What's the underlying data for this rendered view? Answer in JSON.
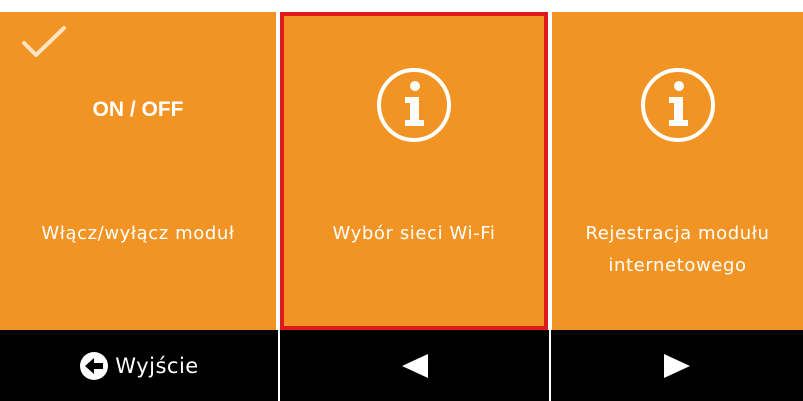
{
  "tiles": [
    {
      "heading": "ON / OFF",
      "label": "Włącz/wyłącz moduł",
      "icon": "checkmark-icon",
      "active": true
    },
    {
      "label": "Wybór sieci Wi-Fi",
      "icon": "info-icon",
      "selected": true
    },
    {
      "label": "Rejestracja modułu internetowego",
      "icon": "info-icon"
    }
  ],
  "footer": {
    "exit_label": "Wyjście",
    "exit_icon": "exit-arrow-icon",
    "prev_icon": "triangle-left-icon",
    "next_icon": "triangle-right-icon"
  },
  "colors": {
    "tile": "#f29424",
    "selection_border": "#e0191b",
    "footer": "#000000",
    "text": "#ffffff"
  }
}
